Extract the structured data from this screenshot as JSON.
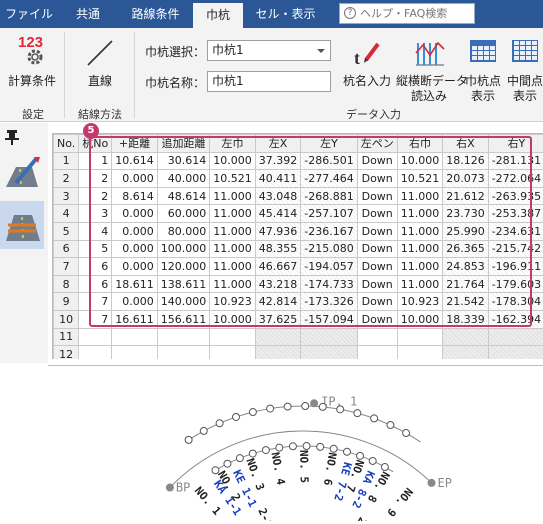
{
  "tabs": [
    {
      "label": "ファイル",
      "active": false
    },
    {
      "label": "共通",
      "active": false
    },
    {
      "label": "路線条件",
      "active": false
    },
    {
      "label": "巾杭",
      "active": true
    },
    {
      "label": "セル・表示",
      "active": false
    }
  ],
  "help_search": {
    "placeholder": "ヘルプ・FAQ検索"
  },
  "ribbon": {
    "calc_conditions": {
      "icon_text": "123",
      "label": "計算条件"
    },
    "straight_line": {
      "label": "直線"
    },
    "pile_select": {
      "label": "巾杭選択：",
      "value": "巾杭1"
    },
    "pile_name": {
      "label": "巾杭名称：",
      "value": "巾杭1"
    },
    "name_input": {
      "label": "杭名入力"
    },
    "profile_import": {
      "label_line1": "縦横断データ",
      "label_line2": "読込み"
    },
    "pile_point_display": {
      "label_line1": "巾杭点",
      "label_line2": "表示"
    },
    "mid_point_display": {
      "label_line1": "中間点",
      "label_line2": "表示"
    },
    "groups": {
      "settings": "設定",
      "connection": "結線方法",
      "data_input": "データ入力"
    }
  },
  "grid": {
    "badge": "5",
    "columns": [
      "No.",
      "杭No",
      "+距離",
      "追加距離",
      "左巾",
      "左X",
      "左Y",
      "左ペン",
      "右巾",
      "右X",
      "右Y",
      "右"
    ],
    "rows": [
      [
        "1",
        "1",
        "10.614",
        "30.614",
        "10.000",
        "37.392",
        "-286.501",
        "Down",
        "10.000",
        "18.126",
        "-281.131",
        "Do"
      ],
      [
        "2",
        "2",
        "0.000",
        "40.000",
        "10.521",
        "40.411",
        "-277.464",
        "Down",
        "10.521",
        "20.073",
        "-272.064",
        "Do"
      ],
      [
        "3",
        "2",
        "8.614",
        "48.614",
        "11.000",
        "43.048",
        "-268.881",
        "Down",
        "11.000",
        "21.612",
        "-263.935",
        "Do"
      ],
      [
        "4",
        "3",
        "0.000",
        "60.000",
        "11.000",
        "45.414",
        "-257.107",
        "Down",
        "11.000",
        "23.730",
        "-253.387",
        "Do"
      ],
      [
        "5",
        "4",
        "0.000",
        "80.000",
        "11.000",
        "47.936",
        "-236.167",
        "Down",
        "11.000",
        "25.990",
        "-234.631",
        "Do"
      ],
      [
        "6",
        "5",
        "0.000",
        "100.000",
        "11.000",
        "48.355",
        "-215.080",
        "Down",
        "11.000",
        "26.365",
        "-215.742",
        "Do"
      ],
      [
        "7",
        "6",
        "0.000",
        "120.000",
        "11.000",
        "46.667",
        "-194.057",
        "Down",
        "11.000",
        "24.853",
        "-196.911",
        "Do"
      ],
      [
        "8",
        "6",
        "18.611",
        "138.611",
        "11.000",
        "43.218",
        "-174.733",
        "Down",
        "11.000",
        "21.764",
        "-179.603",
        "Do"
      ],
      [
        "9",
        "7",
        "0.000",
        "140.000",
        "10.923",
        "42.814",
        "-173.326",
        "Down",
        "10.923",
        "21.542",
        "-178.304",
        "Do"
      ],
      [
        "10",
        "7",
        "16.611",
        "156.611",
        "10.000",
        "37.625",
        "-157.094",
        "Down",
        "10.000",
        "18.339",
        "-162.394",
        "Do"
      ]
    ],
    "empty_rows": [
      "11",
      "12"
    ]
  },
  "plan": {
    "bp": "BP",
    "ep": "EP",
    "ip": "IP. 1",
    "stations": [
      "NO. 1",
      "NO. 2",
      "NO. 3",
      "NO. 4",
      "NO. 5",
      "NO. 6",
      "NO. 7",
      "NO. 8",
      "NO. 9"
    ],
    "blue_labels": [
      "KA 1-1",
      "KE 1-1",
      "KE 7-2",
      "KA 8-2"
    ],
    "offset_labels": [
      "2-1",
      "2-2"
    ]
  }
}
